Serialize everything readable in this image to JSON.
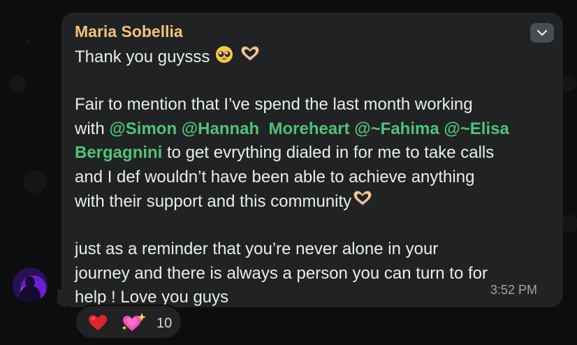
{
  "message": {
    "sender": "Maria Sobellia",
    "time": "3:52 PM",
    "line1_text": "Thank you guysss",
    "line2_part1": "Fair to mention that I’ve spend the last month working",
    "line3_prefix": "with",
    "line3_mention1": "@Simon",
    "line3_mention2": "@Hannah  Moreheart",
    "line3_mention3": "@~Fahima",
    "line3_mention4": "@~Elisa",
    "line4_mention": "Bergagnini",
    "line4_rest": "to get evrything dialed in for me to take calls",
    "line5": "and I def wouldn’t have been able to achieve anything",
    "line6": "with their support and this community",
    "line7": "just as a reminder that you’re never alone in your",
    "line8": "journey and there is always a person you can turn to for",
    "line9": "help ! Love you guys"
  },
  "emojis": {
    "pleading_face": "pleading-face",
    "heart_hands": "heart-hands"
  },
  "reactions": {
    "items": [
      "red-heart",
      "sparkling-heart"
    ],
    "count": "10"
  },
  "colors": {
    "sender_name": "#f2c37a",
    "mention": "#4fc27a",
    "bubble": "#202223",
    "background": "#0b0d0e",
    "text": "#e9edef",
    "timestamp": "#a3a7aa"
  }
}
